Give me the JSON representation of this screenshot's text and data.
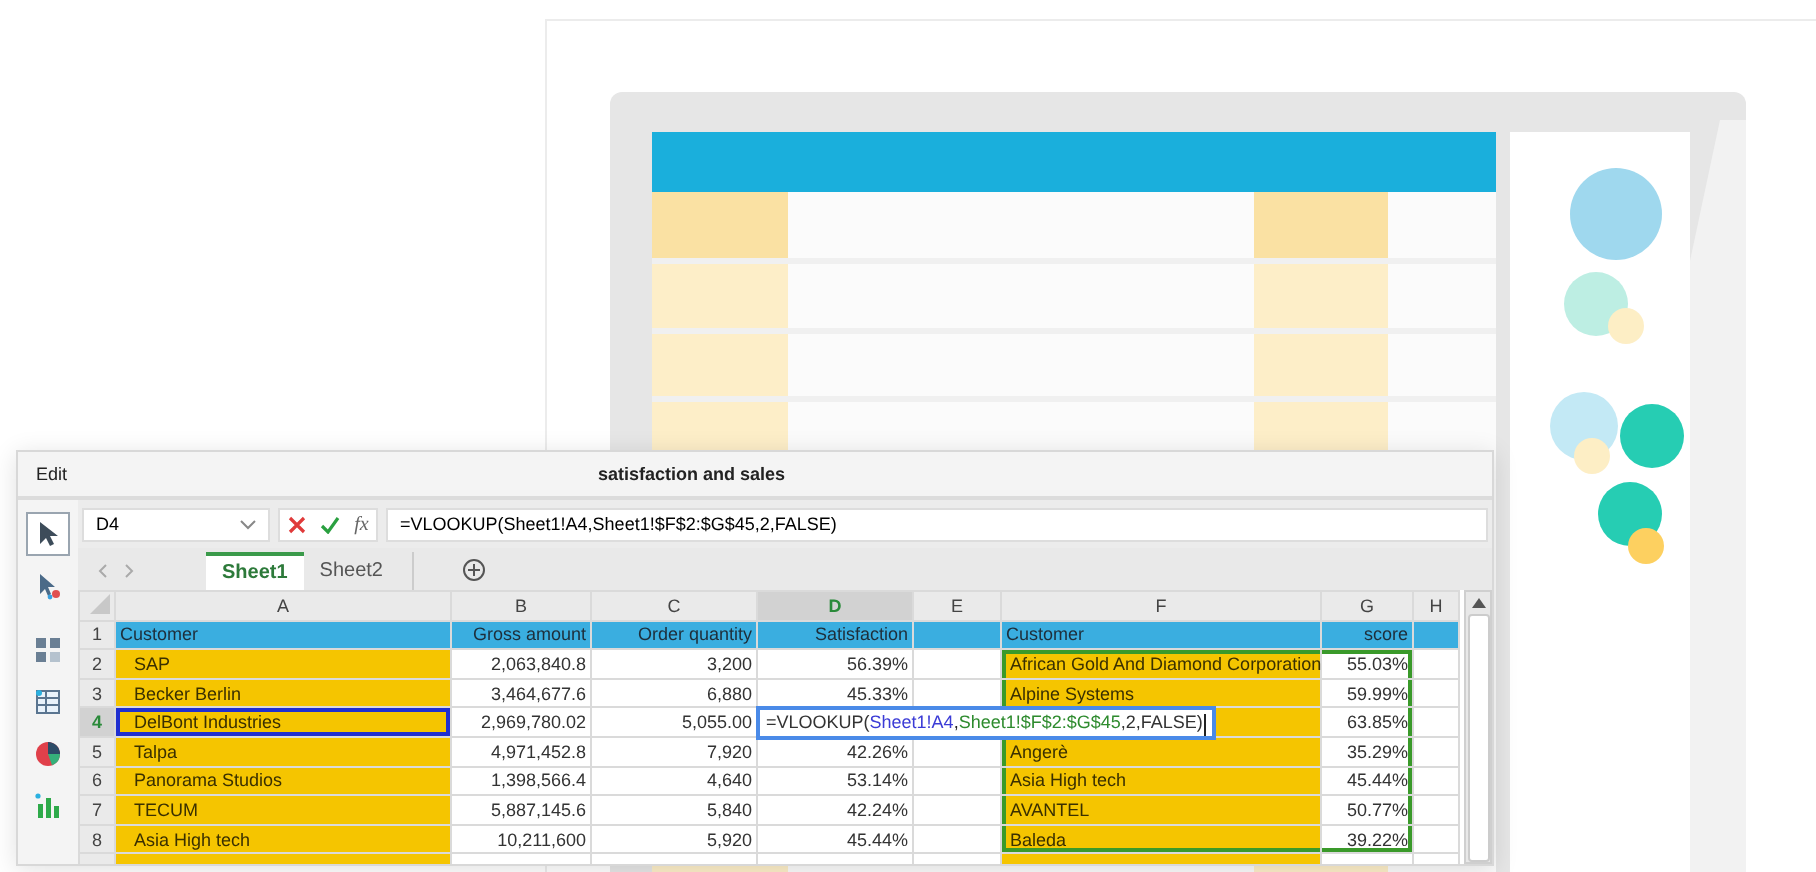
{
  "window": {
    "menu": "Edit",
    "title": "satisfaction and sales"
  },
  "tools": [
    {
      "kind": "pointer",
      "selected": true
    },
    {
      "kind": "sparkle-pointer",
      "selected": false
    },
    {
      "kind": "grid",
      "selected": false
    },
    {
      "kind": "table",
      "selected": false
    },
    {
      "kind": "pie",
      "selected": false
    },
    {
      "kind": "bar",
      "selected": false
    }
  ],
  "formula_bar": {
    "name_box": "D4",
    "fx": "fx",
    "formula": "=VLOOKUP(Sheet1!A4,Sheet1!$F$2:$G$45,2,FALSE)"
  },
  "sheet_tabs": [
    {
      "label": "Sheet1",
      "selected": true
    },
    {
      "label": "Sheet2",
      "selected": false
    }
  ],
  "grid": {
    "columns": [
      {
        "letter": "A",
        "kind": "name",
        "selected": false,
        "highlighted": true,
        "outlined": true
      },
      {
        "letter": "B",
        "kind": "number",
        "selected": false,
        "highlighted": false
      },
      {
        "letter": "C",
        "kind": "number",
        "selected": false,
        "highlighted": false
      },
      {
        "letter": "D",
        "kind": "number",
        "selected": true,
        "highlighted": false
      },
      {
        "letter": "E",
        "selected": false,
        "highlighted": false
      },
      {
        "letter": "F",
        "kind": "text",
        "selected": false,
        "highlighted": true,
        "in_range": true
      },
      {
        "letter": "G",
        "kind": "number",
        "selected": false,
        "highlighted": false,
        "in_range": true
      },
      {
        "letter": "H",
        "selected": false,
        "highlighted": false
      }
    ],
    "rows": [
      {
        "number": "1",
        "selected": false,
        "kind": "header",
        "cells": {
          "A": "Customer",
          "B": "Gross amount",
          "C": "Order quantity",
          "D": "Satisfaction",
          "F": "Customer",
          "G": "score"
        }
      },
      {
        "number": "2",
        "selected": false,
        "in_range": true,
        "kind": "data",
        "cells": {
          "A": "SAP",
          "B": "2,063,840.8",
          "C": "3,200",
          "D": "56.39%",
          "F": "African Gold And Diamond Corporation",
          "G": "55.03%"
        }
      },
      {
        "number": "3",
        "selected": false,
        "in_range": true,
        "kind": "data",
        "cells": {
          "A": "Becker Berlin",
          "B": "3,464,677.6",
          "C": "6,880",
          "D": "45.33%",
          "F": "Alpine Systems",
          "G": "59.99%"
        }
      },
      {
        "number": "4",
        "selected": true,
        "outlined": true,
        "in_range": true,
        "kind": "data",
        "cells": {
          "A": "DelBont Industries",
          "B": "2,969,780.02",
          "C": "5,055.00",
          "G": "63.85%"
        },
        "editor": {
          "parts": [
            {
              "text": "=VLOOKUP("
            },
            {
              "text": "Sheet1!A4",
              "color": "#3b3bd6",
              "separator": ","
            },
            {
              "text": "Sheet1!$F$2:$G$45",
              "color": "#2e8b2e"
            },
            {
              "text": ",2,FALSE)"
            }
          ]
        }
      },
      {
        "number": "5",
        "selected": false,
        "in_range": true,
        "kind": "data",
        "cells": {
          "A": "Talpa",
          "B": "4,971,452.8",
          "C": "7,920",
          "D": "42.26%",
          "F": "Angerè",
          "G": "35.29%"
        }
      },
      {
        "number": "6",
        "selected": false,
        "in_range": true,
        "kind": "data",
        "cells": {
          "A": "Panorama Studios",
          "B": "1,398,566.4",
          "C": "4,640",
          "D": "53.14%",
          "F": "Asia High tech",
          "G": "45.44%"
        }
      },
      {
        "number": "7",
        "selected": false,
        "in_range": true,
        "kind": "data",
        "cells": {
          "A": "TECUM",
          "B": "5,887,145.6",
          "C": "5,840",
          "D": "42.24%",
          "F": "AVANTEL",
          "G": "50.77%"
        }
      },
      {
        "number": "8",
        "selected": false,
        "in_range": true,
        "kind": "data",
        "cells": {
          "A": "Asia High tech",
          "B": "10,211,600",
          "C": "5,920",
          "D": "45.44%",
          "F": "Baleda",
          "G": "39.22%"
        }
      }
    ]
  }
}
